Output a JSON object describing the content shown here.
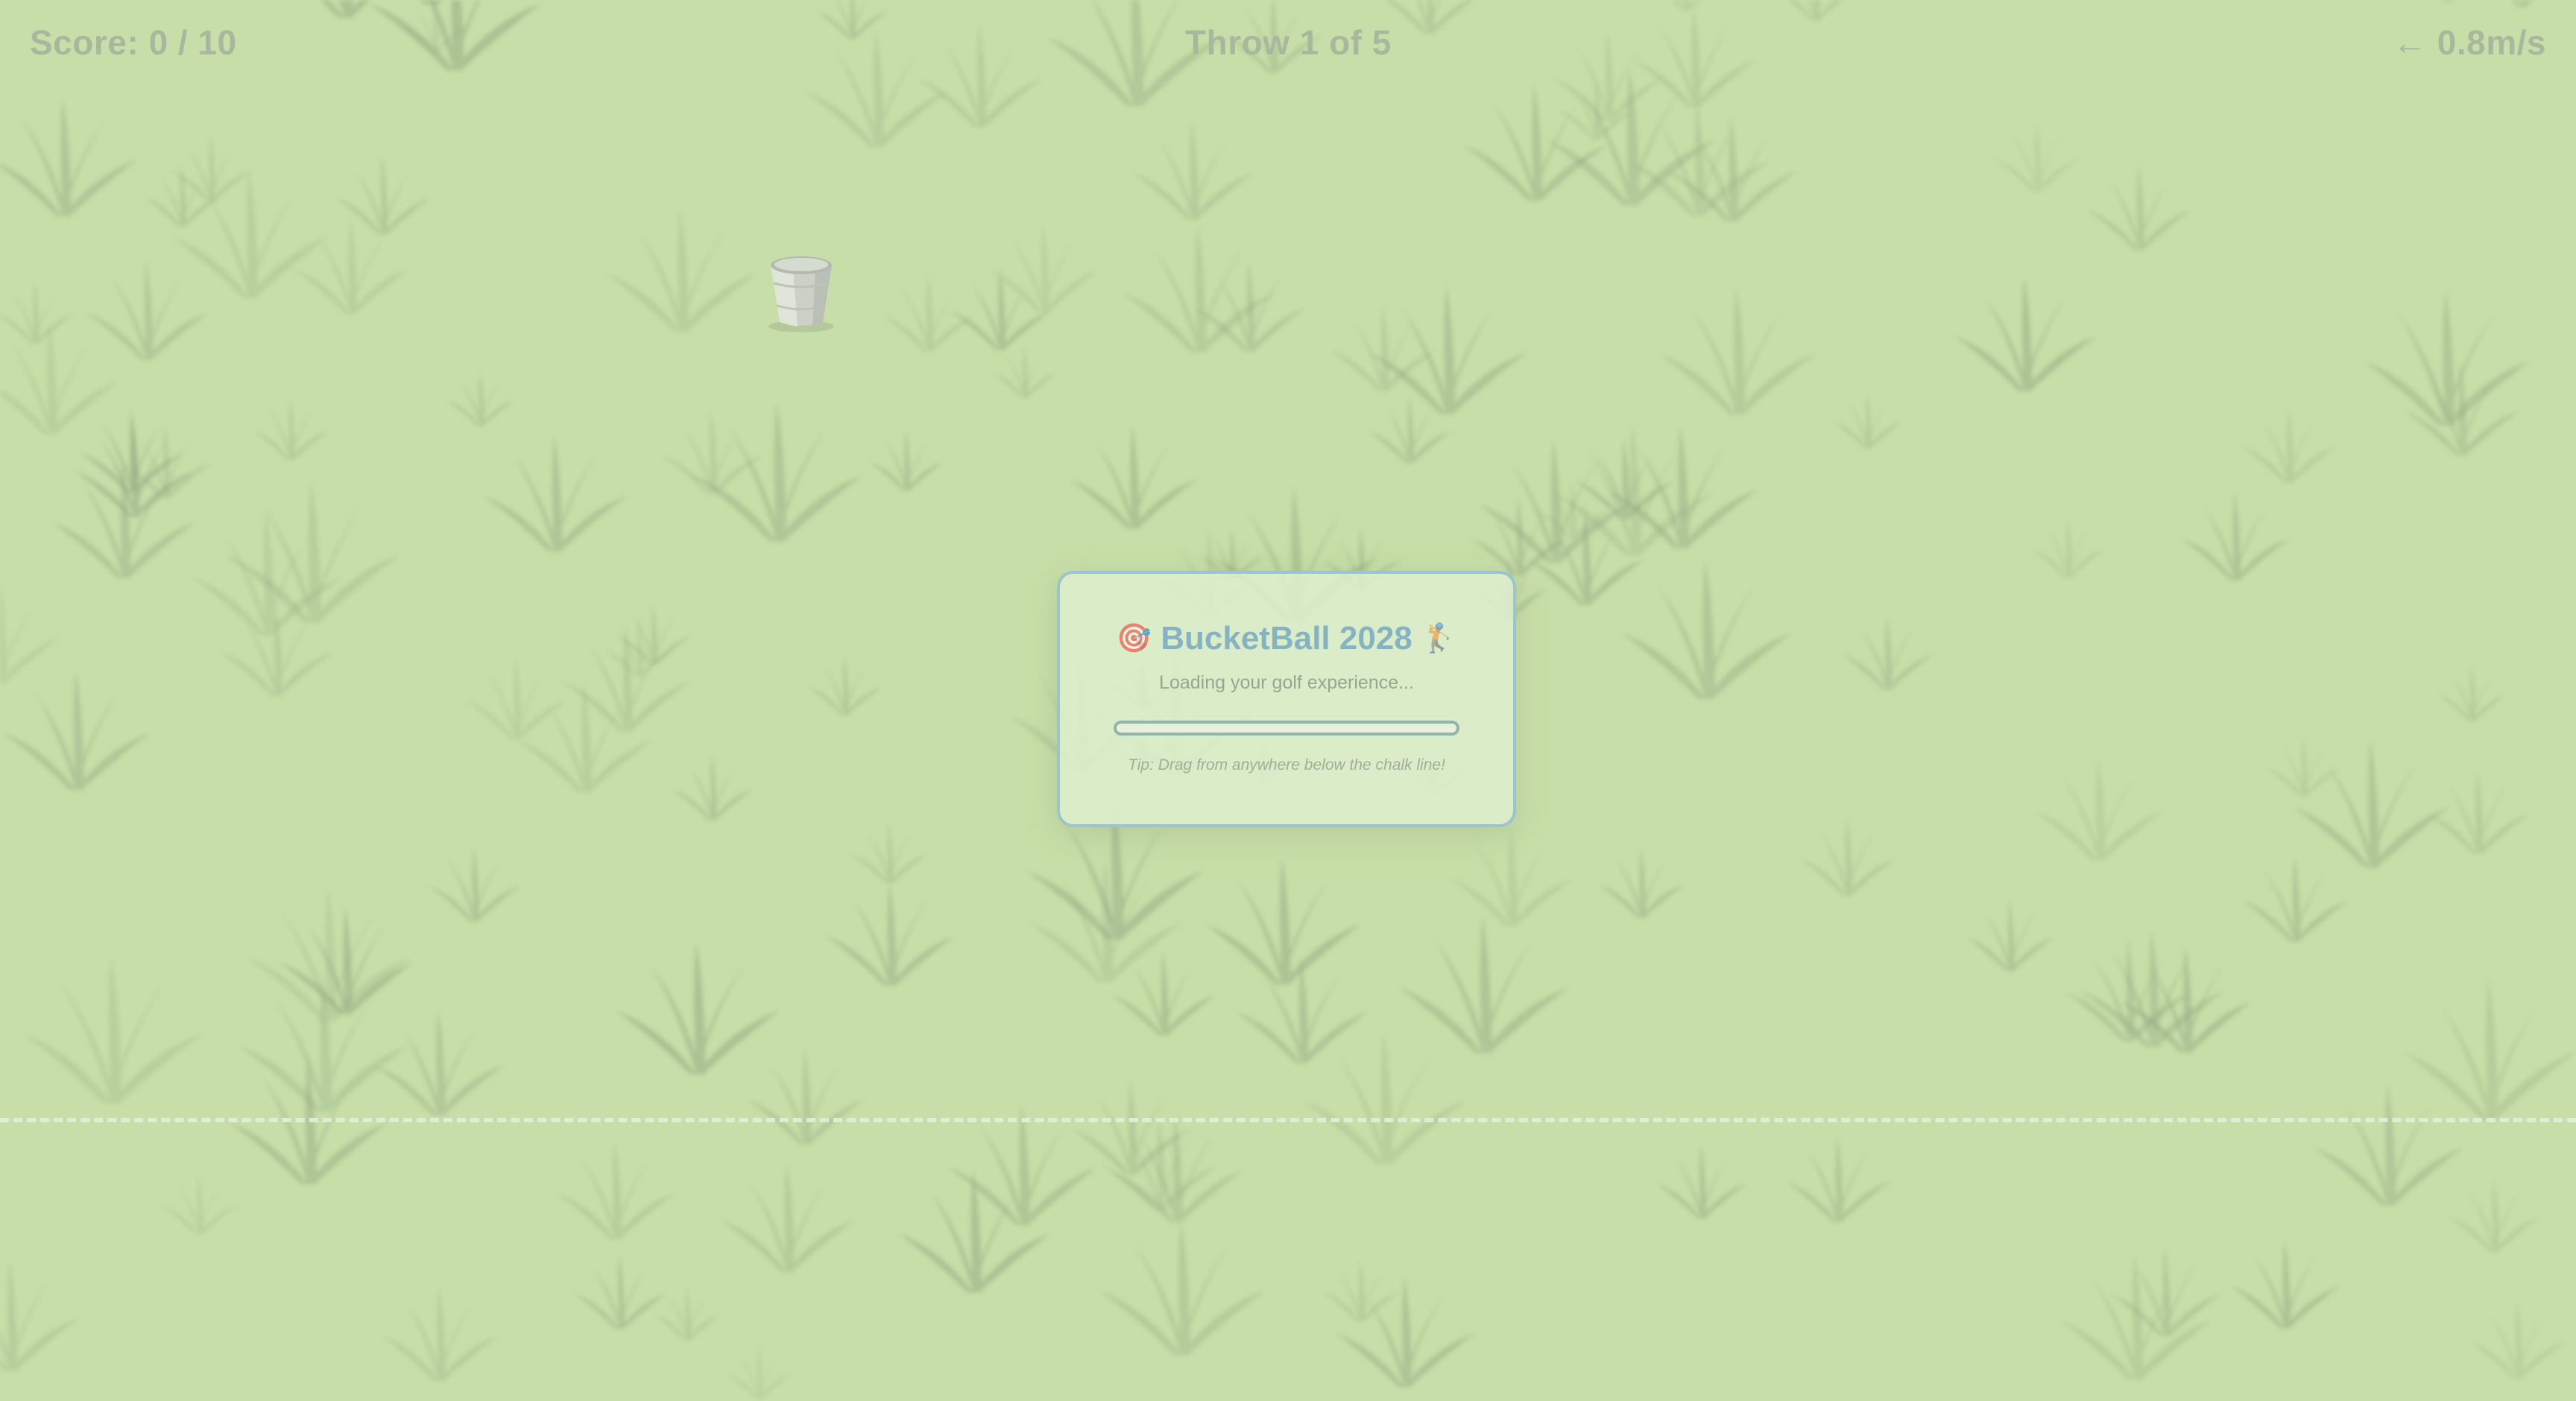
{
  "hud": {
    "score": "Score: 0 / 10",
    "throw": "Throw 1 of 5",
    "wind": "← 0.8m/s"
  },
  "loading": {
    "title": "BucketBall 2028",
    "subtitle": "Loading your golf experience...",
    "progress": 0,
    "tip": "Tip: Drag from anywhere below the chalk line!",
    "title_icon_left": "target-icon",
    "title_icon_right": "golfer-icon"
  },
  "colors": {
    "grass": "#c4dca0",
    "accent": "#86b3c2",
    "chalk": "#eaf3e0"
  }
}
